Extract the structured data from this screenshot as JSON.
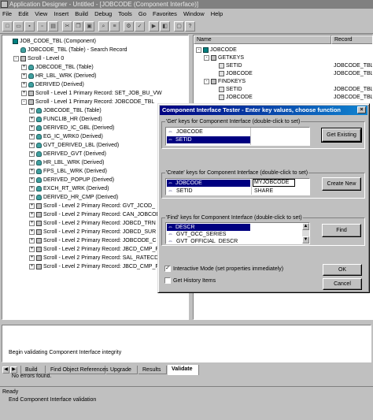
{
  "window": {
    "title": "Application Designer - Untitled - [JOBCODE (Component Interface)]"
  },
  "menu": [
    "File",
    "Edit",
    "View",
    "Insert",
    "Build",
    "Debug",
    "Tools",
    "Go",
    "Favorites",
    "Window",
    "Help"
  ],
  "tree": {
    "nodes": [
      {
        "indent": 0,
        "expander": "",
        "icon": "component",
        "label": "JOB_CODE_TBL (Component)"
      },
      {
        "indent": 1,
        "expander": "",
        "icon": "db",
        "label": "JOBCODE_TBL (Table) - Search Record"
      },
      {
        "indent": 1,
        "expander": "-",
        "icon": "scroll",
        "label": "Scroll - Level 0"
      },
      {
        "indent": 2,
        "expander": "+",
        "icon": "db",
        "label": "JOBCODE_TBL (Table)"
      },
      {
        "indent": 2,
        "expander": "+",
        "icon": "db",
        "label": "HR_LBL_WRK (Derived)"
      },
      {
        "indent": 2,
        "expander": "+",
        "icon": "db",
        "label": "DERIVED (Derived)"
      },
      {
        "indent": 2,
        "expander": "+",
        "icon": "scroll",
        "label": "Scroll - Level 1  Primary Record: SET_JOB_BU_VW"
      },
      {
        "indent": 2,
        "expander": "-",
        "icon": "scroll",
        "label": "Scroll - Level 1  Primary Record: JOBCODE_TBL"
      },
      {
        "indent": 3,
        "expander": "+",
        "icon": "db",
        "label": "JOBCODE_TBL (Table)"
      },
      {
        "indent": 3,
        "expander": "+",
        "icon": "db",
        "label": "FUNCLIB_HR (Derived)"
      },
      {
        "indent": 3,
        "expander": "+",
        "icon": "db",
        "label": "DERIVED_IC_GBL (Derived)"
      },
      {
        "indent": 3,
        "expander": "+",
        "icon": "db",
        "label": "EG_IC_WRK0 (Derived)"
      },
      {
        "indent": 3,
        "expander": "+",
        "icon": "db",
        "label": "GVT_DERIVED_LBL (Derived)"
      },
      {
        "indent": 3,
        "expander": "+",
        "icon": "db",
        "label": "DERIVED_GVT (Derived)"
      },
      {
        "indent": 3,
        "expander": "+",
        "icon": "db",
        "label": "HR_LBL_WRK (Derived)"
      },
      {
        "indent": 3,
        "expander": "+",
        "icon": "db",
        "label": "FPS_LBL_WRK (Derived)"
      },
      {
        "indent": 3,
        "expander": "+",
        "icon": "db",
        "label": "DERIVED_POPUP (Derived)"
      },
      {
        "indent": 3,
        "expander": "+",
        "icon": "db",
        "label": "EXCH_RT_WRK (Derived)"
      },
      {
        "indent": 3,
        "expander": "+",
        "icon": "db",
        "label": "DERIVED_HR_CMP (Derived)"
      },
      {
        "indent": 3,
        "expander": "+",
        "icon": "scroll",
        "label": "Scroll - Level 2  Primary Record: GVT_JCOD_"
      },
      {
        "indent": 3,
        "expander": "+",
        "icon": "scroll",
        "label": "Scroll - Level 2  Primary Record: CAN_JOBCOD"
      },
      {
        "indent": 3,
        "expander": "+",
        "icon": "scroll",
        "label": "Scroll - Level 2  Primary Record: JOBCD_TRN"
      },
      {
        "indent": 3,
        "expander": "+",
        "icon": "scroll",
        "label": "Scroll - Level 2  Primary Record: JOBCD_SUR"
      },
      {
        "indent": 3,
        "expander": "+",
        "icon": "scroll",
        "label": "Scroll - Level 2  Primary Record: JOBCODE_C"
      },
      {
        "indent": 3,
        "expander": "+",
        "icon": "scroll",
        "label": "Scroll - Level 2  Primary Record: JBCD_CMP_F"
      },
      {
        "indent": 3,
        "expander": "+",
        "icon": "scroll",
        "label": "Scroll - Level 2  Primary Record: SAL_RATECD"
      },
      {
        "indent": 3,
        "expander": "+",
        "icon": "scroll",
        "label": "Scroll - Level 2  Primary Record: JBCD_CMP_F"
      }
    ]
  },
  "right_pane": {
    "headers": [
      "Name",
      "Record"
    ],
    "rows": [
      {
        "indent": 0,
        "expander": "-",
        "icon": "ci",
        "name": "JOBCODE",
        "record": ""
      },
      {
        "indent": 1,
        "expander": "-",
        "icon": "key",
        "name": "GETKEYS",
        "record": ""
      },
      {
        "indent": 2,
        "expander": "",
        "icon": "field",
        "name": "SETID",
        "record": "JOBCODE_TBL"
      },
      {
        "indent": 2,
        "expander": "",
        "icon": "field",
        "name": "JOBCODE",
        "record": "JOBCODE_TBL"
      },
      {
        "indent": 1,
        "expander": "-",
        "icon": "key",
        "name": "FINDKEYS",
        "record": ""
      },
      {
        "indent": 2,
        "expander": "",
        "icon": "field",
        "name": "SETID",
        "record": "JOBCODE_TBL"
      },
      {
        "indent": 2,
        "expander": "",
        "icon": "field",
        "name": "JOBCODE",
        "record": "JOBCODE_TBL"
      }
    ]
  },
  "dialog": {
    "title": "Component Interface Tester - Enter key values, choose function",
    "get_group": {
      "caption": "'Get' keys for Component Interface (double-click to set)",
      "rows": [
        {
          "key": "JOBCODE",
          "value": ""
        },
        {
          "key": "SETID",
          "value": ""
        }
      ]
    },
    "create_group": {
      "caption": "'Create' keys for Component Interface (double-click to set)",
      "rows": [
        {
          "key": "JOBCODE",
          "value": "MYJOBCODE"
        },
        {
          "key": "SETID",
          "value": "SHARE"
        }
      ]
    },
    "find_group": {
      "caption": "'Find' keys for Component Interface (double-click to set)",
      "rows": [
        "DESCR",
        "GVT_OCC_SERIES",
        "GVT_OFFICIAL_DESCR"
      ]
    },
    "buttons": {
      "get_existing": "Get Existing",
      "create_new": "Create New",
      "find": "Find",
      "ok": "OK",
      "cancel": "Cancel"
    },
    "interactive_mode": {
      "label": "Interactive Mode (set properties immediately)",
      "checked": true
    },
    "get_history": {
      "label": "Get History Items",
      "checked": false
    }
  },
  "output": {
    "lines": [
      "Begin validating Component Interface integrity",
      "  No errors found.",
      "End Component Interface validation"
    ]
  },
  "tabs": [
    {
      "label": "Build",
      "active": false
    },
    {
      "label": "Find Object References",
      "active": false
    },
    {
      "label": "Upgrade",
      "active": false
    },
    {
      "label": "Results",
      "active": false
    },
    {
      "label": "Validate",
      "active": true
    }
  ],
  "status": "Ready"
}
